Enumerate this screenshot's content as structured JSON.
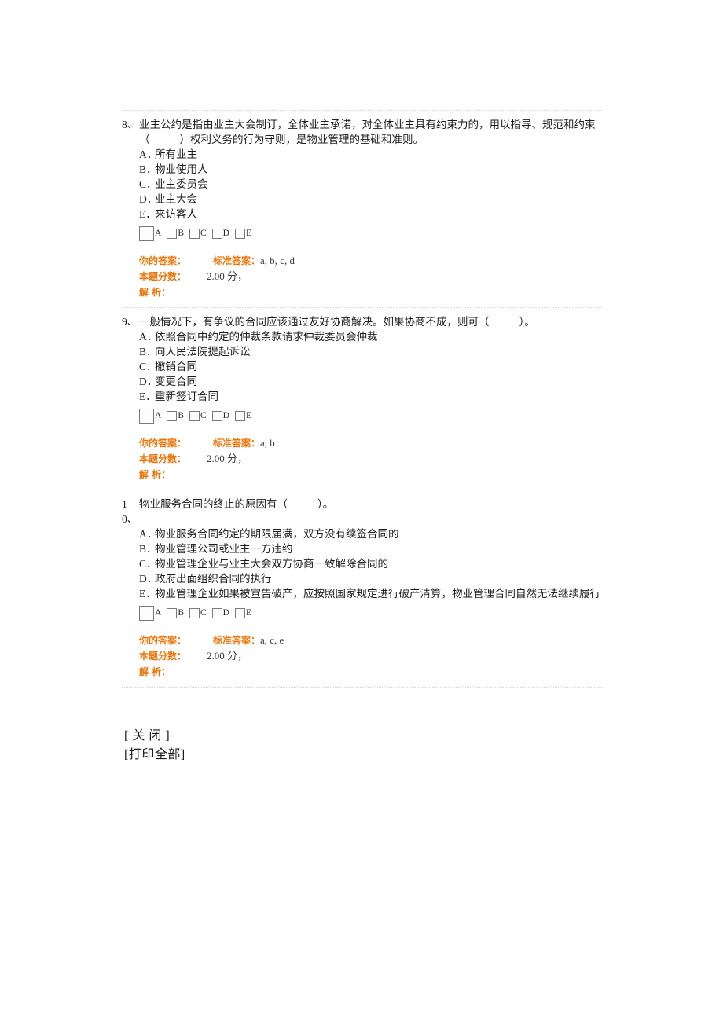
{
  "colors": {
    "accent_orange": "#ef7407",
    "body_text": "#1c1c1c",
    "value_text": "#3b3b3b",
    "separator": "#d9d4de",
    "checkbox_border": "#7a7a7a",
    "background": "#ffffff"
  },
  "labels": {
    "your_answer": "你的答案：",
    "standard_answer": "标准答案：",
    "score": "本题分数：",
    "analysis": "解    析：",
    "blank_marker": "（       ）"
  },
  "checkbox_labels": [
    "A",
    "B",
    "C",
    "D",
    "E"
  ],
  "questions": [
    {
      "number": "8",
      "number_suffix": "、",
      "stem_part1": "业主公约是指由业主大会制订，全体业主承诺，对全体业主具有约束力的，用以指导、规范和约束（",
      "stem_part2": "）权利义务的行为守则，是物业管理的基础和准则。",
      "options": [
        {
          "letter": "A．",
          "text": "所有业主"
        },
        {
          "letter": "B．",
          "text": "物业使用人"
        },
        {
          "letter": "C．",
          "text": "业主委员会"
        },
        {
          "letter": "D．",
          "text": "业主大会"
        },
        {
          "letter": "E．",
          "text": "来访客人"
        }
      ],
      "your_answer_value": "",
      "standard_answer_value": "a, b, c, d",
      "score_value": "2.00 分，",
      "analysis_value": ""
    },
    {
      "number": "9",
      "number_suffix": "、",
      "stem_part1": "一般情况下，有争议的合同应该通过友好协商解决。如果协商不成，则可（",
      "stem_part2": "）。",
      "options": [
        {
          "letter": "A．",
          "text": "依照合同中约定的仲裁条款请求仲裁委员会仲裁"
        },
        {
          "letter": "B．",
          "text": "向人民法院提起诉讼"
        },
        {
          "letter": "C．",
          "text": "撤销合同"
        },
        {
          "letter": "D．",
          "text": "变更合同"
        },
        {
          "letter": "E．",
          "text": "重新签订合同"
        }
      ],
      "your_answer_value": "",
      "standard_answer_value": "a, b",
      "score_value": "2.00 分，",
      "analysis_value": ""
    },
    {
      "number": "10",
      "number_suffix": "、",
      "stem_part1": "物业服务合同的终止的原因有（",
      "stem_part2": "）。",
      "options": [
        {
          "letter": "A．",
          "text": "物业服务合同约定的期限届满，双方没有续签合同的"
        },
        {
          "letter": "B．",
          "text": "物业管理公司或业主一方违约"
        },
        {
          "letter": "C．",
          "text": "物业管理企业与业主大会双方协商一致解除合同的"
        },
        {
          "letter": "D．",
          "text": "政府出面组织合同的执行"
        },
        {
          "letter": "E．",
          "text": "物业管理企业如果被宣告破产，应按照国家规定进行破产清算，物业管理合同自然无法继续履行"
        }
      ],
      "your_answer_value": "",
      "standard_answer_value": "a, c, e",
      "score_value": "2.00 分，",
      "analysis_value": ""
    }
  ],
  "footer": {
    "close_label": "[ 关 闭 ]",
    "print_all_label": "[打印全部]"
  }
}
